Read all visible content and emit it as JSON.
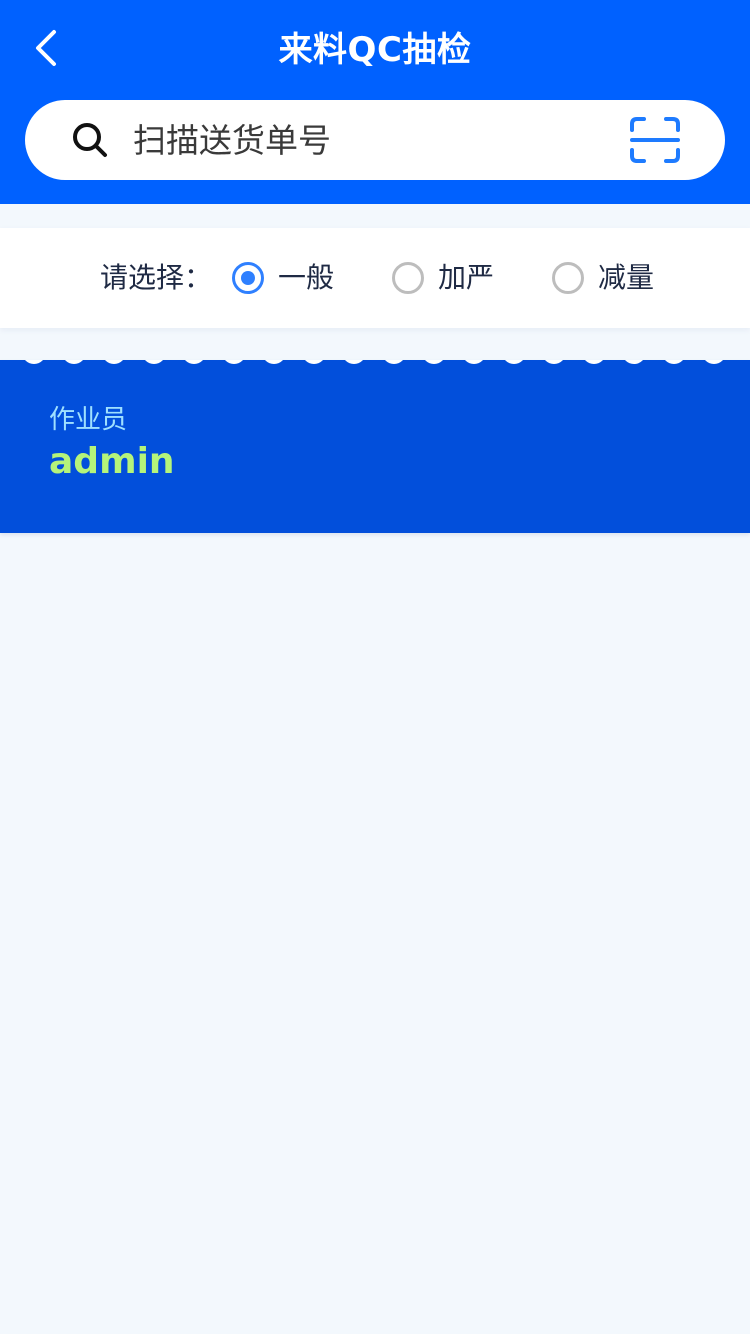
{
  "theme": {
    "primary": "#0061FF",
    "card_bg": "#024FDB",
    "page_bg": "#F3F8FD",
    "radio_active": "#2F80FF",
    "operator_label_color": "#9FE0FF",
    "operator_value_color": "#B5F47A"
  },
  "header": {
    "title": "来料QC抽检",
    "back_icon": "chevron-left-icon"
  },
  "search": {
    "placeholder": "扫描送货单号",
    "value": "",
    "search_icon": "search-icon",
    "scan_icon": "scan-icon"
  },
  "options": {
    "label": "请选择：",
    "items": [
      {
        "label": "一般",
        "checked": true
      },
      {
        "label": "加严",
        "checked": false
      },
      {
        "label": "减量",
        "checked": false
      }
    ]
  },
  "operator": {
    "label": "作业员",
    "value": "admin"
  }
}
